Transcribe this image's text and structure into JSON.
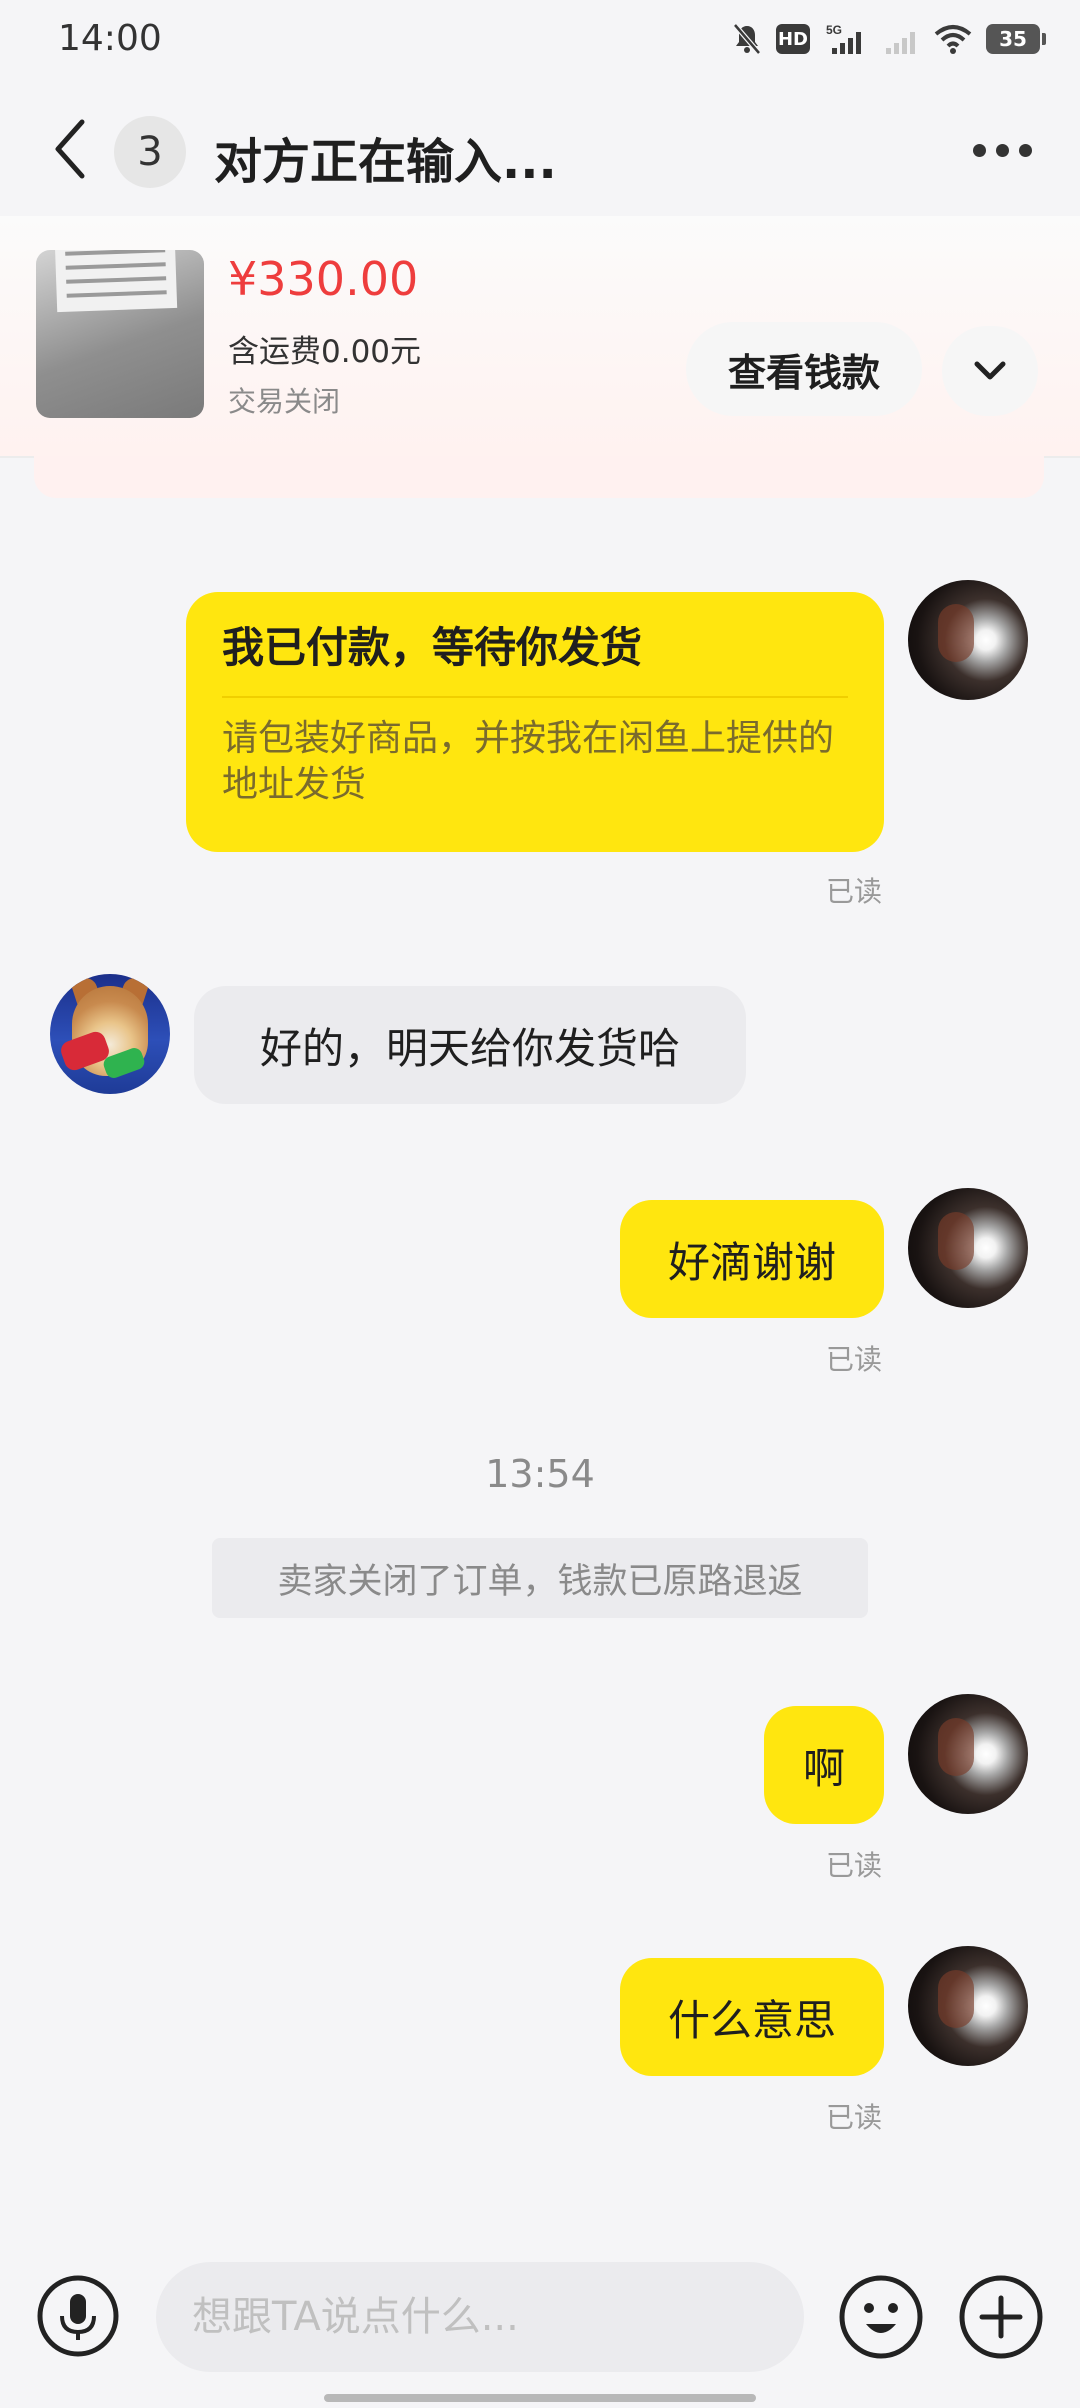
{
  "status_bar": {
    "time": "14:00",
    "hd_label": "HD",
    "network": "5G",
    "battery": "35"
  },
  "header": {
    "unread_count": "3",
    "title": "对方正在输入..."
  },
  "product": {
    "price": "¥330.00",
    "shipping": "含运费0.00元",
    "status": "交易关闭",
    "view_button": "查看钱款"
  },
  "messages": {
    "payment_card": {
      "title": "我已付款，等待你发货",
      "desc": "请包装好商品，并按我在闲鱼上提供的地址发货",
      "read": "已读"
    },
    "seller_reply": "好的，明天给你发货哈",
    "msg_thanks": {
      "text": "好滴谢谢",
      "read": "已读"
    },
    "time_label": "13:54",
    "system_note": "卖家关闭了订单，钱款已原路退返",
    "msg_ah": {
      "text": "啊",
      "read": "已读"
    },
    "msg_what": {
      "text": "什么意思",
      "read": "已读"
    }
  },
  "input": {
    "placeholder": "想跟TA说点什么..."
  },
  "colors": {
    "accent_yellow": "#ffe60f",
    "price_red": "#ee3d3d",
    "bubble_gray": "#ebebee"
  }
}
